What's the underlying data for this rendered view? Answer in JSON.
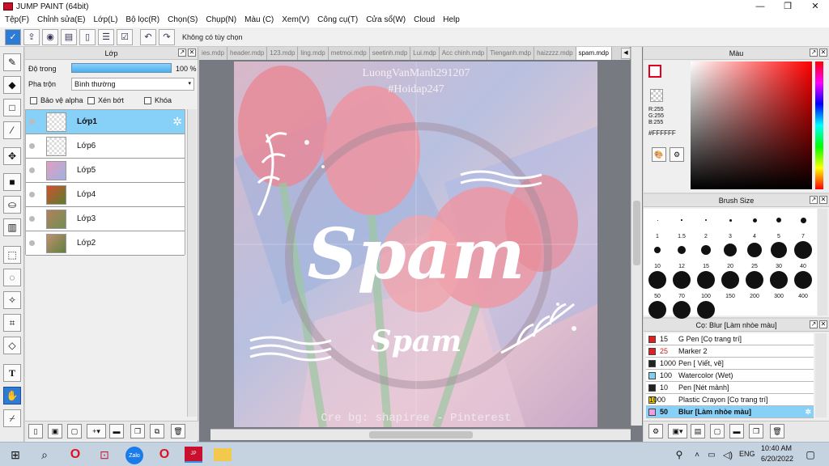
{
  "window": {
    "title": "JUMP PAINT (64bit)",
    "controls": [
      "—",
      "❐",
      "✕"
    ]
  },
  "menu": [
    "Tệp(F)",
    "Chỉnh sửa(E)",
    "Lớp(L)",
    "Bộ lọc(R)",
    "Chọn(S)",
    "Chụp(N)",
    "Màu (C)",
    "Xem(V)",
    "Công cụ(T)",
    "Cửa sổ(W)",
    "Cloud",
    "Help"
  ],
  "toolbar": {
    "hint": "Không có tùy chọn"
  },
  "layer_panel": {
    "title": "Lớp",
    "opacity_label": "Độ trong",
    "opacity_value": "100 %",
    "opacity_fraction": 1.0,
    "blend_label": "Pha trộn",
    "blend_value": "Bình thường",
    "protect_alpha": "Bảo vệ alpha",
    "clipping": "Xén bớt",
    "lock": "Khóa",
    "layers": [
      {
        "name": "Lớp1",
        "selected": true
      },
      {
        "name": "Lớp6",
        "selected": false
      },
      {
        "name": "Lớp5",
        "selected": false
      },
      {
        "name": "Lớp4",
        "selected": false
      },
      {
        "name": "Lớp3",
        "selected": false
      },
      {
        "name": "Lớp2",
        "selected": false
      }
    ]
  },
  "doc_tabs": [
    "ies.mdp",
    "header.mdp",
    "123.mdp",
    "ling.mdp",
    "metmoi.mdp",
    "seetinh.mdp",
    "Lui.mdp",
    "Acc chinh.mdp",
    "Tienganh.mdp",
    "haizzzz.mdp",
    "spam.mdp"
  ],
  "canvas_text": {
    "watermark_name": "LuongVanManh291207",
    "watermark_tag": "#Hoidap247",
    "big_title": "Spam",
    "small_title": "Spam",
    "credit": "Cre bg: shapiree - Pinterest"
  },
  "color_panel": {
    "title": "Màu",
    "r": "R:255",
    "g": "G:255",
    "b": "B:255",
    "hex": "#FFFFFF"
  },
  "brush_panel": {
    "title": "Brush Size",
    "sizes": [
      "1",
      "1.5",
      "2",
      "3",
      "4",
      "5",
      "7",
      "10",
      "12",
      "15",
      "20",
      "25",
      "30",
      "40",
      "50",
      "70",
      "100",
      "150",
      "200",
      "300",
      "400",
      "",
      "",
      ""
    ]
  },
  "preset_panel": {
    "title": "Cọ: Blur [Làm nhòe màu]",
    "presets": [
      {
        "size": "15",
        "name": "G Pen [Cọ trang trí]",
        "color": "#e02020",
        "selected": false
      },
      {
        "size": "25",
        "name": "Marker 2",
        "color": "#e02020",
        "selected": false
      },
      {
        "size": "1000",
        "name": "Pen [ Viết, vẽ]",
        "color": "#222222",
        "selected": false
      },
      {
        "size": "100",
        "name": "Watercolor (Wet)",
        "color": "#80d0f0",
        "selected": false
      },
      {
        "size": "10",
        "name": "Pen [Nét mảnh]",
        "color": "#222222",
        "selected": false
      },
      {
        "size": "1000",
        "name": "Plastic Crayon [Cọ trang trí]",
        "color": "#f0d000",
        "selected": false
      },
      {
        "size": "50",
        "name": "Blur [Làm nhòe màu]",
        "color": "#f0a0e0",
        "selected": true
      }
    ]
  },
  "taskbar": {
    "lang": "ENG",
    "time": "10:40 AM",
    "date": "6/20/2022"
  }
}
